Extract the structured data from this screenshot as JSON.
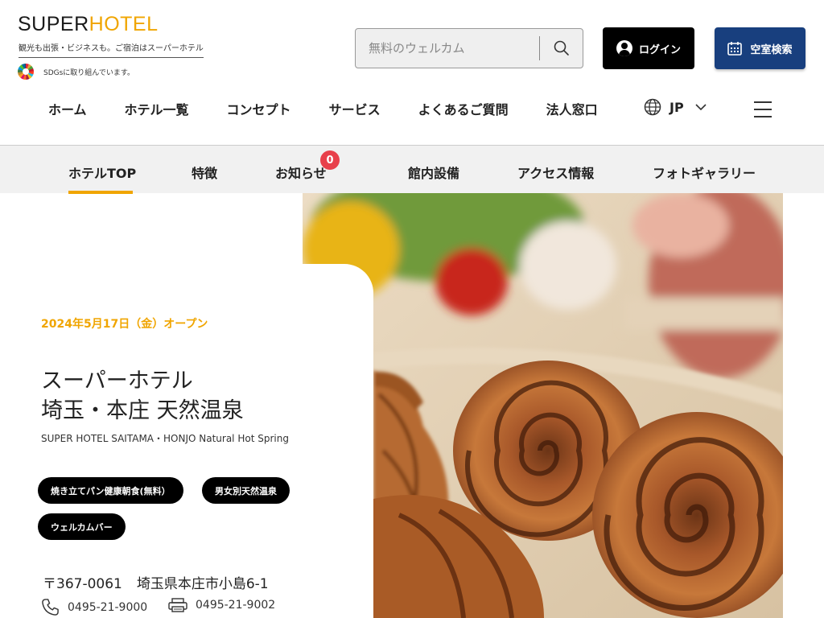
{
  "header": {
    "logo": {
      "part1": "SUPER",
      "part2": "HOTEL"
    },
    "tagline": "観光も出張・ビジネスも。ご宿泊はスーパーホテル",
    "sdgs_text": "SDGsに取り組んでいます。",
    "search": {
      "placeholder": "無料のウェルカム"
    },
    "login_label": "ログイン",
    "vacancy_label": "空室検索",
    "nav": [
      "ホーム",
      "ホテル一覧",
      "コンセプト",
      "サービス",
      "よくあるご質問",
      "法人窓口"
    ],
    "language": "JP"
  },
  "subnav": {
    "items": [
      "ホテルTOP",
      "特徴",
      "お知らせ",
      "館内設備",
      "アクセス情報",
      "フォトギャラリー"
    ],
    "active": "ホテルTOP",
    "notice_count": "0"
  },
  "hotel": {
    "open_date": "2024年5月17日（金）オープン",
    "name_line1": "スーパーホテル",
    "name_line2": "埼玉・本庄 天然温泉",
    "name_en": "SUPER HOTEL SAITAMA・HONJO Natural Hot Spring",
    "tags": [
      "焼き立てパン健康朝食(無料）",
      "男女別天然温泉",
      "ウェルカムバー"
    ],
    "zip": "〒367-0061",
    "address": "埼玉県本庄市小島6-1",
    "phone": "0495-21-9000",
    "fax": "0495-21-9002"
  },
  "colors": {
    "accent": "#f0a500",
    "navy": "#183f7e",
    "badge": "#e8404b"
  },
  "icons": [
    "search-icon",
    "user-icon",
    "calendar-icon",
    "globe-icon",
    "chevron-down-icon",
    "menu-icon",
    "phone-icon",
    "fax-icon",
    "sdgs-icon"
  ]
}
